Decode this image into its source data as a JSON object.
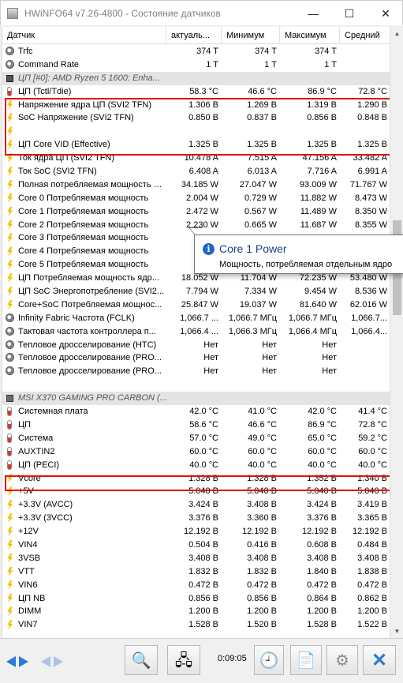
{
  "window": {
    "title": "HWiNFO64 v7.26-4800 - Состояние датчиков",
    "min_glyph": "—",
    "max_glyph": "☐",
    "close_glyph": "✕"
  },
  "columns": {
    "name": "Датчик",
    "current": "актуаль...",
    "min": "Минимум",
    "max": "Максимум",
    "avg": "Средний"
  },
  "rows": [
    {
      "icon": "circle",
      "name": "Trfc",
      "cur": "374 T",
      "min": "374 T",
      "max": "374 T",
      "avg": ""
    },
    {
      "icon": "circle",
      "name": "Command Rate",
      "cur": "1 T",
      "min": "1 T",
      "max": "1 T",
      "avg": ""
    },
    {
      "type": "group",
      "icon": "chip",
      "name": "ЦП [#0]: AMD Ryzen 5 1600: Enha..."
    },
    {
      "icon": "therm",
      "name": "ЦП (Tctl/Tdie)",
      "cur": "58.3 °C",
      "min": "46.6 °C",
      "max": "86.9 °C",
      "avg": "72.8 °C"
    },
    {
      "icon": "bolt",
      "name": "Напряжение ядра ЦП (SVI2 TFN)",
      "cur": "1.306 В",
      "min": "1.269 В",
      "max": "1.319 В",
      "avg": "1.290 В"
    },
    {
      "icon": "bolt",
      "name": "SoC Напряжение (SVI2 TFN)",
      "cur": "0.850 В",
      "min": "0.837 В",
      "max": "0.856 В",
      "avg": "0.848 В"
    },
    {
      "type": "blank",
      "icon": "bolt",
      "name": "",
      "cur": "",
      "min": "",
      "max": "",
      "avg": ""
    },
    {
      "icon": "bolt",
      "name": "ЦП Core VID (Effective)",
      "cur": "1.325 В",
      "min": "1.325 В",
      "max": "1.325 В",
      "avg": "1.325 В"
    },
    {
      "icon": "bolt",
      "name": "Ток ядра ЦП (SVI2 TFN)",
      "cur": "10.478 A",
      "min": "7.515 A",
      "max": "47.156 A",
      "avg": "33.482 A"
    },
    {
      "icon": "bolt",
      "name": "Ток SoC (SVI2 TFN)",
      "cur": "6.408 A",
      "min": "6.013 A",
      "max": "7.716 A",
      "avg": "6.991 A"
    },
    {
      "icon": "bolt",
      "name": "Полная потребляемая мощность ЦП",
      "cur": "34.185 W",
      "min": "27.047 W",
      "max": "93.009 W",
      "avg": "71.767 W"
    },
    {
      "icon": "bolt",
      "name": "Core 0 Потребляемая мощность",
      "cur": "2.004 W",
      "min": "0.729 W",
      "max": "11.882 W",
      "avg": "8.473 W"
    },
    {
      "icon": "bolt",
      "name": "Core 1 Потребляемая мощность",
      "cur": "2.472 W",
      "min": "0.567 W",
      "max": "11.489 W",
      "avg": "8.350 W"
    },
    {
      "icon": "bolt",
      "name": "Core 2 Потребляемая мощность",
      "cur": "2.230 W",
      "min": "0.665 W",
      "max": "11.687 W",
      "avg": "8.355 W"
    },
    {
      "icon": "bolt",
      "name": "Core 3 Потребляемая мощность",
      "cur": "",
      "min": "",
      "max": "",
      "avg": ""
    },
    {
      "icon": "bolt",
      "name": "Core 4 Потребляемая мощность",
      "cur": "",
      "min": "",
      "max": "",
      "avg": ""
    },
    {
      "icon": "bolt",
      "name": "Core 5 Потребляемая мощность",
      "cur": "",
      "min": "",
      "max": "",
      "avg": ""
    },
    {
      "icon": "bolt",
      "name": "ЦП Потребляемая мощность ядр...",
      "cur": "18.052 W",
      "min": "11.704 W",
      "max": "72.235 W",
      "avg": "53.480 W"
    },
    {
      "icon": "bolt",
      "name": "ЦП SoC Энергопотребление (SVI2...",
      "cur": "7.794 W",
      "min": "7.334 W",
      "max": "9.454 W",
      "avg": "8.536 W"
    },
    {
      "icon": "bolt",
      "name": "Core+SoC Потребляемая мощнос...",
      "cur": "25.847 W",
      "min": "19.037 W",
      "max": "81.640 W",
      "avg": "62.016 W"
    },
    {
      "icon": "circle",
      "name": "Infinity Fabric Частота (FCLK)",
      "cur": "1,066.7 ...",
      "min": "1,066.7 МГц",
      "max": "1,066.7 МГц",
      "avg": "1,066.7..."
    },
    {
      "icon": "circle",
      "name": "Тактовая частота контроллера п...",
      "cur": "1,066.4 ...",
      "min": "1,066.3 МГц",
      "max": "1,066.4 МГц",
      "avg": "1,066.4..."
    },
    {
      "icon": "circle",
      "name": "Тепловое дросселирование (HTC)",
      "cur": "Нет",
      "min": "Нет",
      "max": "Нет",
      "avg": ""
    },
    {
      "icon": "circle",
      "name": "Тепловое дросселирование (PRO...",
      "cur": "Нет",
      "min": "Нет",
      "max": "Нет",
      "avg": ""
    },
    {
      "icon": "circle",
      "name": "Тепловое дросселирование (PRO...",
      "cur": "Нет",
      "min": "Нет",
      "max": "Нет",
      "avg": ""
    },
    {
      "type": "spacer",
      "name": ""
    },
    {
      "type": "group",
      "icon": "board",
      "name": "MSI X370 GAMING PRO CARBON (..."
    },
    {
      "icon": "therm",
      "name": "Системная плата",
      "cur": "42.0 °C",
      "min": "41.0 °C",
      "max": "42.0 °C",
      "avg": "41.4 °C"
    },
    {
      "icon": "therm",
      "name": "ЦП",
      "cur": "58.6 °C",
      "min": "46.6 °C",
      "max": "86.9 °C",
      "avg": "72.8 °C"
    },
    {
      "icon": "therm",
      "name": "Система",
      "cur": "57.0 °C",
      "min": "49.0 °C",
      "max": "65.0 °C",
      "avg": "59.2 °C"
    },
    {
      "icon": "therm",
      "name": "AUXTIN2",
      "cur": "60.0 °C",
      "min": "60.0 °C",
      "max": "60.0 °C",
      "avg": "60.0 °C"
    },
    {
      "icon": "therm",
      "name": "ЦП (PECI)",
      "cur": "40.0 °C",
      "min": "40.0 °C",
      "max": "40.0 °C",
      "avg": "40.0 °C"
    },
    {
      "icon": "bolt",
      "name": "Vcore",
      "cur": "1.328 В",
      "min": "1.328 В",
      "max": "1.352 В",
      "avg": "1.340 В"
    },
    {
      "icon": "bolt",
      "name": "+5V",
      "cur": "5.040 В",
      "min": "5.040 В",
      "max": "5.040 В",
      "avg": "5.040 В"
    },
    {
      "icon": "bolt",
      "name": "+3.3V (AVCC)",
      "cur": "3.424 В",
      "min": "3.408 В",
      "max": "3.424 В",
      "avg": "3.419 В"
    },
    {
      "icon": "bolt",
      "name": "+3.3V (3VCC)",
      "cur": "3.376 В",
      "min": "3.360 В",
      "max": "3.376 В",
      "avg": "3.365 В"
    },
    {
      "icon": "bolt",
      "name": "+12V",
      "cur": "12.192 В",
      "min": "12.192 В",
      "max": "12.192 В",
      "avg": "12.192 В"
    },
    {
      "icon": "bolt",
      "name": "VIN4",
      "cur": "0.504 В",
      "min": "0.416 В",
      "max": "0.608 В",
      "avg": "0.484 В"
    },
    {
      "icon": "bolt",
      "name": "3VSB",
      "cur": "3.408 В",
      "min": "3.408 В",
      "max": "3.408 В",
      "avg": "3.408 В"
    },
    {
      "icon": "bolt",
      "name": "VTT",
      "cur": "1.832 В",
      "min": "1.832 В",
      "max": "1.840 В",
      "avg": "1.838 В"
    },
    {
      "icon": "bolt",
      "name": "VIN6",
      "cur": "0.472 В",
      "min": "0.472 В",
      "max": "0.472 В",
      "avg": "0.472 В"
    },
    {
      "icon": "bolt",
      "name": "ЦП NB",
      "cur": "0.856 В",
      "min": "0.856 В",
      "max": "0.864 В",
      "avg": "0.862 В"
    },
    {
      "icon": "bolt",
      "name": "DIMM",
      "cur": "1.200 В",
      "min": "1.200 В",
      "max": "1.200 В",
      "avg": "1.200 В"
    },
    {
      "icon": "bolt",
      "name": "VIN7",
      "cur": "1.528 В",
      "min": "1.520 В",
      "max": "1.528 В",
      "avg": "1.522 В"
    }
  ],
  "tooltip": {
    "icon": "info-icon",
    "title": "Core 1 Power",
    "body": "Мощность, потребляемая отдельным ядро"
  },
  "toolbar": {
    "elapsed": "0:09:05"
  },
  "colors": {
    "highlight": "#e01010",
    "tooltip_title": "#1a3e8a",
    "info_icon": "#1e66c8",
    "bolt": "#f1c40f"
  }
}
